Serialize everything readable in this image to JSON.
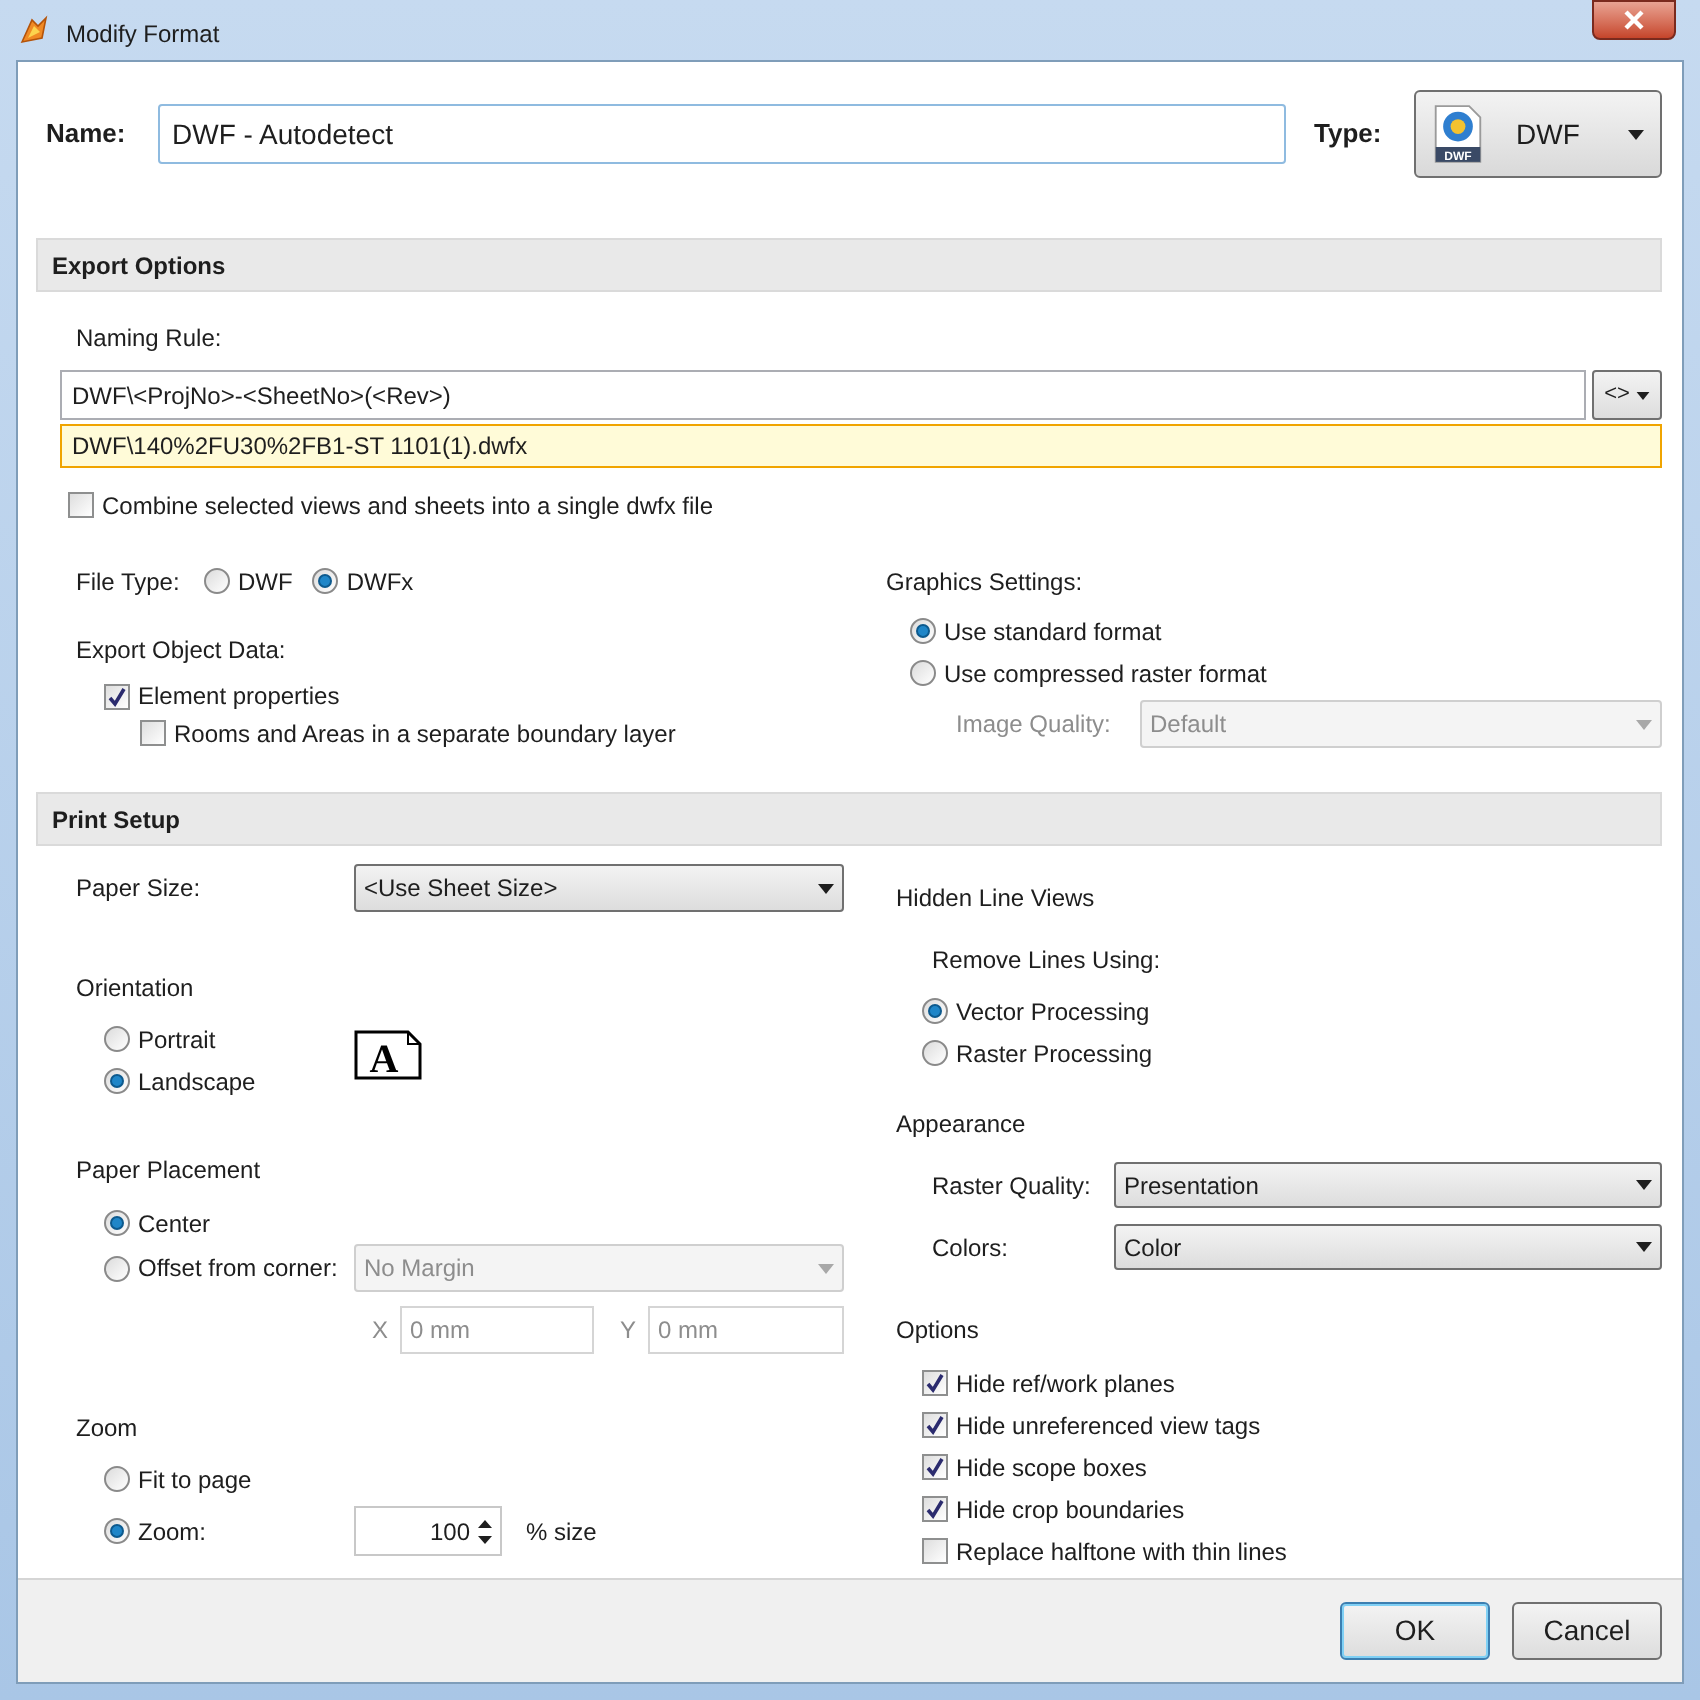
{
  "window": {
    "title": "Modify Format"
  },
  "name": {
    "label": "Name:",
    "value": "DWF - Autodetect"
  },
  "type": {
    "label": "Type:",
    "value": "DWF",
    "icon_label": "DWF"
  },
  "export_options": {
    "title": "Export Options",
    "naming_rule_label": "Naming Rule:",
    "naming_rule": "DWF\\<ProjNo>-<SheetNo>(<Rev>)",
    "insert_button": "<>",
    "preview": "DWF\\140%2FU30%2FB1-ST 1101(1).dwfx",
    "combine": {
      "label": "Combine selected views and sheets into a single dwfx file",
      "checked": false
    },
    "file_type": {
      "label": "File Type:",
      "options": [
        {
          "label": "DWF",
          "selected": false
        },
        {
          "label": "DWFx",
          "selected": true
        }
      ]
    },
    "export_object_data": {
      "label": "Export Object Data:",
      "items": [
        {
          "label": "Element properties",
          "checked": true,
          "children": [
            {
              "label": "Rooms and Areas in a separate boundary layer",
              "checked": false
            }
          ]
        }
      ]
    },
    "graphics_settings": {
      "label": "Graphics Settings:",
      "options": [
        {
          "label": "Use standard format",
          "selected": true
        },
        {
          "label": "Use compressed raster format",
          "selected": false
        }
      ],
      "image_quality": {
        "label": "Image Quality:",
        "value": "Default",
        "disabled": true
      }
    }
  },
  "print_setup": {
    "title": "Print Setup",
    "paper_size": {
      "label": "Paper Size:",
      "value": "<Use Sheet Size>"
    },
    "orientation": {
      "label": "Orientation",
      "icon_letter": "A",
      "options": [
        {
          "label": "Portrait",
          "selected": false
        },
        {
          "label": "Landscape",
          "selected": true
        }
      ]
    },
    "paper_placement": {
      "label": "Paper Placement",
      "options": [
        {
          "label": "Center",
          "selected": true
        },
        {
          "label": "Offset from corner:",
          "selected": false
        }
      ],
      "margin": {
        "value": "No Margin",
        "disabled": true
      },
      "x": {
        "label": "X",
        "value": "0 mm",
        "disabled": true
      },
      "y": {
        "label": "Y",
        "value": "0 mm",
        "disabled": true
      }
    },
    "zoom": {
      "label": "Zoom",
      "options": [
        {
          "label": "Fit to page",
          "selected": false
        },
        {
          "label": "Zoom:",
          "selected": true
        }
      ],
      "value": "100",
      "unit": "% size"
    },
    "hidden_line_views": {
      "label": "Hidden Line Views",
      "remove_label": "Remove Lines Using:",
      "options": [
        {
          "label": "Vector Processing",
          "selected": true
        },
        {
          "label": "Raster Processing",
          "selected": false
        }
      ]
    },
    "appearance": {
      "label": "Appearance",
      "raster_quality": {
        "label": "Raster Quality:",
        "value": "Presentation"
      },
      "colors": {
        "label": "Colors:",
        "value": "Color"
      }
    },
    "options": {
      "label": "Options",
      "items": [
        {
          "label": "Hide ref/work planes",
          "checked": true
        },
        {
          "label": "Hide unreferenced view tags",
          "checked": true
        },
        {
          "label": "Hide scope boxes",
          "checked": true
        },
        {
          "label": "Hide crop boundaries",
          "checked": true
        },
        {
          "label": "Replace halftone with thin lines",
          "checked": false
        }
      ]
    }
  },
  "buttons": [
    {
      "label": "OK",
      "default": true
    },
    {
      "label": "Cancel",
      "default": false
    }
  ]
}
